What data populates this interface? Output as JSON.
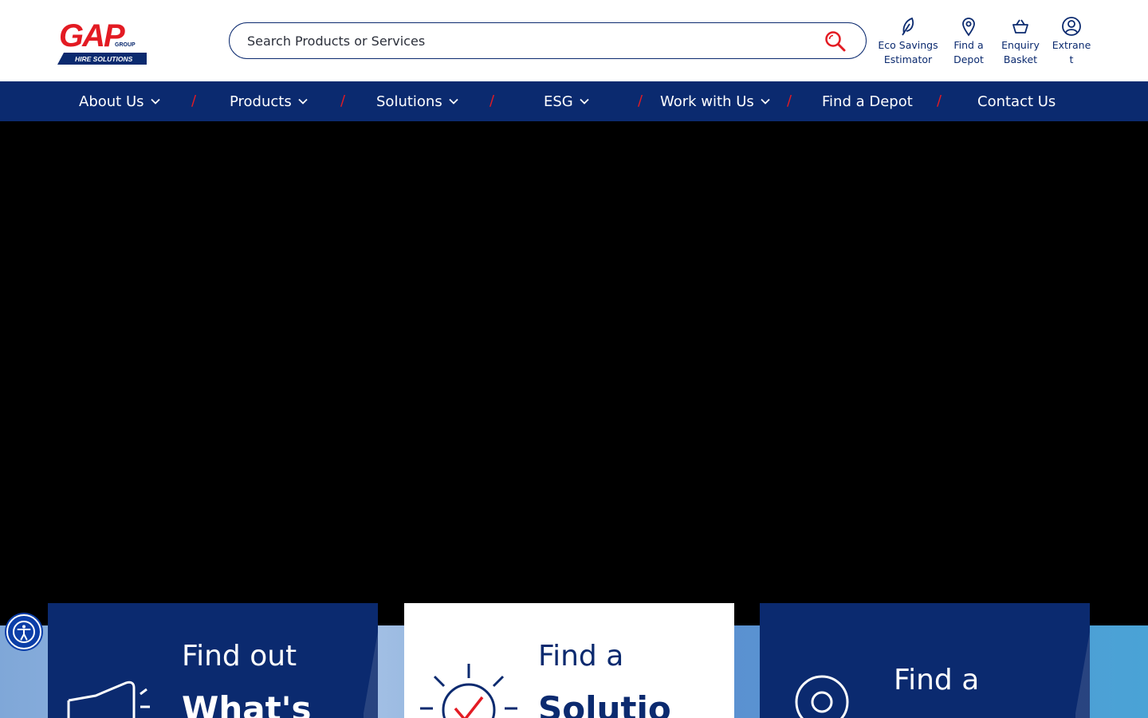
{
  "brand": {
    "logo_text": "GAP",
    "logo_group": "GROUP",
    "logo_sub": "HIRE SOLUTIONS"
  },
  "search": {
    "placeholder": "Search Products or Services"
  },
  "utility": {
    "eco": {
      "line1": "Eco Savings",
      "line2": "Estimator",
      "icon": "leaf-icon"
    },
    "depot": {
      "line1": "Find a",
      "line2": "Depot",
      "icon": "map-pin-icon"
    },
    "basket": {
      "line1": "Enquiry",
      "line2": "Basket",
      "icon": "basket-icon"
    },
    "extranet": {
      "line1": "Extrane",
      "line2": "t",
      "icon": "user-circle-icon"
    }
  },
  "nav": {
    "separator": "/",
    "items": [
      {
        "label": "About Us"
      },
      {
        "label": "Products"
      },
      {
        "label": "Solutions"
      },
      {
        "label": "ESG"
      },
      {
        "label": "Work with Us"
      },
      {
        "label": "Find a Depot"
      },
      {
        "label": "Contact Us"
      }
    ]
  },
  "cards": [
    {
      "line1": "Find out",
      "line2": "What's",
      "icon": "megaphone-icon"
    },
    {
      "line1": "Find a",
      "line2": "Solutio",
      "icon": "lightbulb-check-icon"
    },
    {
      "line1": "Find a",
      "line2": "",
      "icon": "location-target-icon"
    }
  ],
  "colors": {
    "brand_navy": "#0b2a6f",
    "brand_red": "#e31b23"
  },
  "accessibility": {
    "icon": "accessibility-icon"
  }
}
